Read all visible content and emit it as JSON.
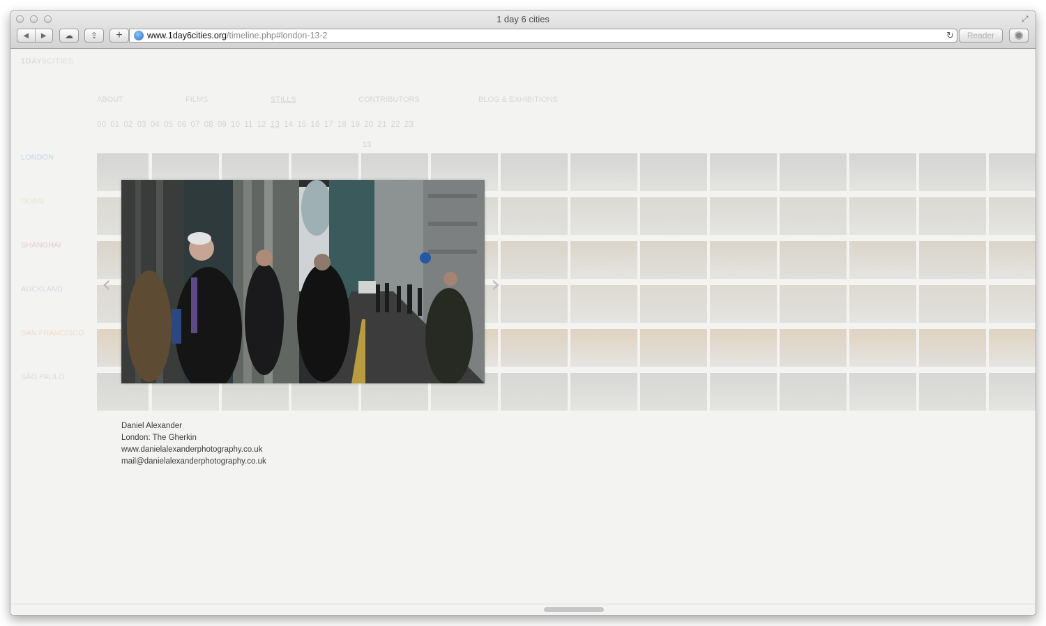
{
  "window": {
    "title": "1 day 6 cities"
  },
  "toolbar": {
    "back_icon": "◀",
    "forward_icon": "▶",
    "cloud_icon": "☁",
    "share_icon": "⇪",
    "add_icon": "+",
    "url_domain": "www.1day6cities.org",
    "url_path": "/timeline.php#london-13-2",
    "reload_icon": "↻",
    "reader_label": "Reader"
  },
  "site": {
    "logo_bold": "1DAY",
    "logo_rest": "6CITIES",
    "nav": [
      "ABOUT",
      "FILMS",
      "STILLS",
      "CONTRIBUTORS",
      "BLOG & EXHIBITIONS"
    ],
    "active_nav": "STILLS",
    "hours": [
      "00",
      "01",
      "02",
      "03",
      "04",
      "05",
      "06",
      "07",
      "08",
      "09",
      "10",
      "11",
      "12",
      "13",
      "14",
      "15",
      "16",
      "17",
      "18",
      "19",
      "20",
      "21",
      "22",
      "23"
    ],
    "active_hour": "13",
    "current_hour_label": "13",
    "cities": [
      {
        "name": "LONDON",
        "color": "#c9d6e6"
      },
      {
        "name": "DUBAI",
        "color": "#e8e6c6"
      },
      {
        "name": "SHANGHAI",
        "color": "#e9c9cf"
      },
      {
        "name": "AUCKLAND",
        "color": "#d7d9e0"
      },
      {
        "name": "SAN FRANCISCO",
        "color": "#eddcc9"
      },
      {
        "name": "SÃO PAULO",
        "color": "#dcdcdc"
      }
    ],
    "prev_icon": "‹",
    "next_icon": "›"
  },
  "caption": {
    "author": "Daniel Alexander",
    "title": "London: The Gherkin",
    "website": "www.danielalexanderphotography.co.uk",
    "email": "mail@danielalexanderphotography.co.uk"
  },
  "colors": {
    "row_tones": [
      "#cfd0cf",
      "#d7d5cf",
      "#d6cfc2",
      "#d9d5cc",
      "#dccdb8",
      "#d2d2d0"
    ]
  }
}
